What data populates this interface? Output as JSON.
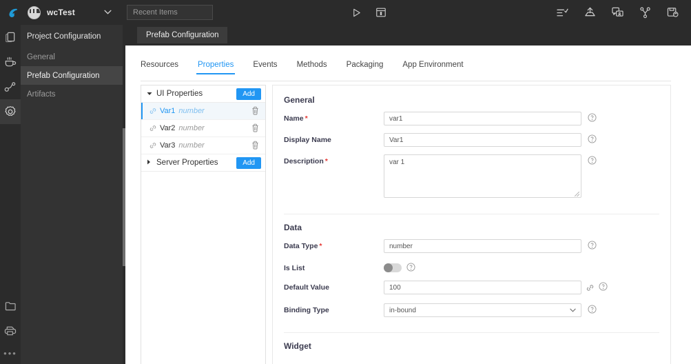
{
  "topbar": {
    "logo_icon": "app-logo-icon",
    "project_name": "wcTest",
    "project_avatar_icon": "project-avatar",
    "chevron_icon": "chevron-down-icon",
    "recent_items_placeholder": "Recent Items",
    "recent_items_value": "",
    "center_tools": [
      {
        "icon": "play-run-icon",
        "name": "run-button"
      },
      {
        "icon": "panel-layout-icon",
        "name": "layout-button"
      }
    ],
    "right_tools": [
      {
        "icon": "list-check-icon",
        "name": "task-list-button"
      },
      {
        "icon": "upload-icon",
        "name": "publish-button"
      },
      {
        "icon": "comments-icon",
        "name": "comments-button"
      },
      {
        "icon": "branch-share-icon",
        "name": "share-button"
      },
      {
        "icon": "save-copy-icon",
        "name": "save-as-button"
      }
    ]
  },
  "rail": {
    "items": [
      {
        "icon": "documents-icon",
        "name": "rail-documents",
        "active": false
      },
      {
        "icon": "coffee-cup-icon",
        "name": "rail-services",
        "active": false
      },
      {
        "icon": "node-graph-icon",
        "name": "rail-flows",
        "active": false
      },
      {
        "icon": "gear-icon",
        "name": "rail-settings",
        "active": true
      }
    ],
    "bottom_items": [
      {
        "icon": "folder-icon",
        "name": "rail-files"
      },
      {
        "icon": "printer-icon",
        "name": "rail-deploy"
      }
    ],
    "more_label": "•••"
  },
  "sidebar": {
    "header": "Project Configuration",
    "items": [
      {
        "label": "General",
        "active": false
      },
      {
        "label": "Prefab Configuration",
        "active": true
      },
      {
        "label": "Artifacts",
        "active": false
      }
    ]
  },
  "workspace_tab": {
    "label": "Prefab Configuration"
  },
  "tabs": [
    {
      "label": "Resources",
      "active": false
    },
    {
      "label": "Properties",
      "active": true
    },
    {
      "label": "Events",
      "active": false
    },
    {
      "label": "Methods",
      "active": false
    },
    {
      "label": "Packaging",
      "active": false
    },
    {
      "label": "App Environment",
      "active": false
    }
  ],
  "property_panel": {
    "groups": [
      {
        "label": "UI Properties",
        "expanded": true,
        "caret_icon": "caret-down-icon",
        "add_label": "Add",
        "items": [
          {
            "name": "Var1",
            "type": "number",
            "selected": true,
            "link_icon": "link-icon",
            "delete_icon": "trash-icon"
          },
          {
            "name": "Var2",
            "type": "number",
            "selected": false,
            "link_icon": "link-icon",
            "delete_icon": "trash-icon"
          },
          {
            "name": "Var3",
            "type": "number",
            "selected": false,
            "link_icon": "link-icon",
            "delete_icon": "trash-icon"
          }
        ]
      },
      {
        "label": "Server Properties",
        "expanded": false,
        "caret_icon": "caret-right-icon",
        "add_label": "Add",
        "items": []
      }
    ]
  },
  "form": {
    "general": {
      "title": "General",
      "name_label": "Name",
      "name_required": "*",
      "name_value": "var1",
      "display_name_label": "Display Name",
      "display_name_value": "Var1",
      "description_label": "Description",
      "description_required": "*",
      "description_value": "var 1",
      "help_icon": "help-circle-icon"
    },
    "data": {
      "title": "Data",
      "data_type_label": "Data Type",
      "data_type_required": "*",
      "data_type_value": "number",
      "is_list_label": "Is List",
      "is_list_value": "off",
      "default_value_label": "Default Value",
      "default_value": "100",
      "default_value_link_icon": "link-icon",
      "binding_type_label": "Binding Type",
      "binding_type_value": "in-bound",
      "binding_type_chevron": "chevron-down-icon"
    },
    "widget": {
      "title": "Widget"
    }
  },
  "colors": {
    "accent": "#2196f3",
    "topbar_bg": "#2b2b2b",
    "nav_bg": "#333333",
    "nav_active_bg": "#454545",
    "required": "#e53935",
    "selected_row_bg": "#f2f7fb"
  }
}
